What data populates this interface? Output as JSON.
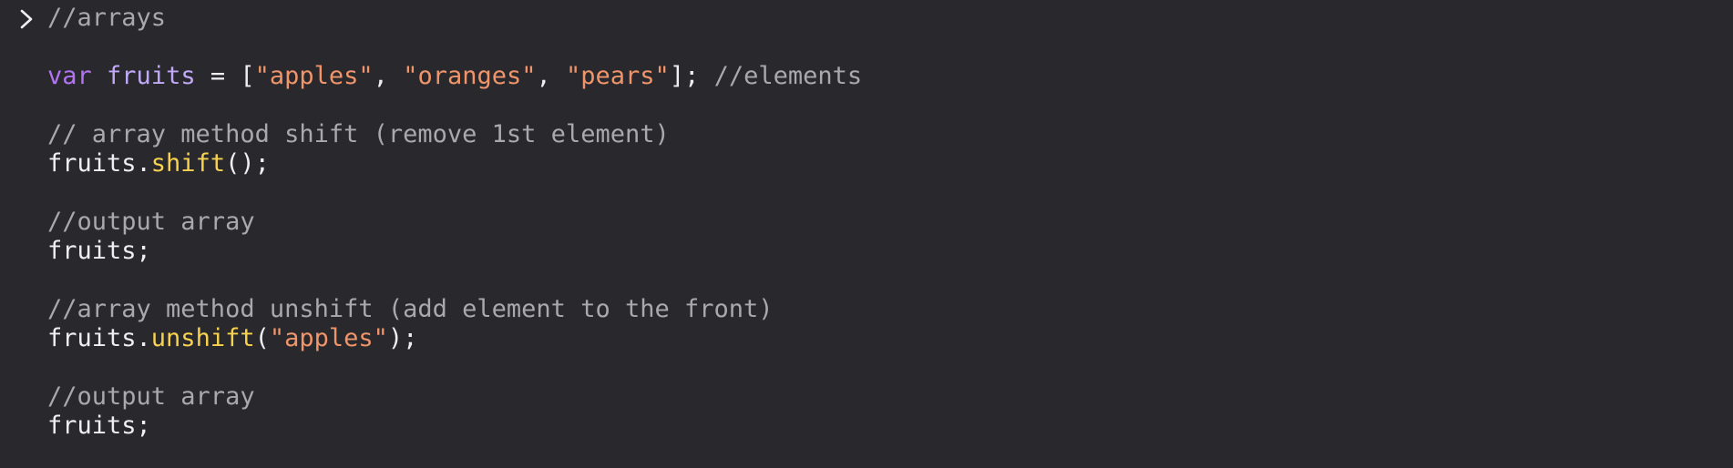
{
  "console": {
    "prompt_icon": "chevron-right-icon",
    "lines": [
      [
        {
          "t": "//arrays",
          "k": "cm"
        }
      ],
      [],
      [
        {
          "t": "var",
          "k": "kw"
        },
        {
          "t": " ",
          "k": "pl"
        },
        {
          "t": "fruits",
          "k": "var"
        },
        {
          "t": " = [",
          "k": "pl"
        },
        {
          "t": "\"apples\"",
          "k": "str"
        },
        {
          "t": ", ",
          "k": "pl"
        },
        {
          "t": "\"oranges\"",
          "k": "str"
        },
        {
          "t": ", ",
          "k": "pl"
        },
        {
          "t": "\"pears\"",
          "k": "str"
        },
        {
          "t": "]; ",
          "k": "pl"
        },
        {
          "t": "//elements",
          "k": "cm"
        }
      ],
      [],
      [
        {
          "t": "// array method shift (remove 1st element)",
          "k": "cm"
        }
      ],
      [
        {
          "t": "fruits.",
          "k": "pl"
        },
        {
          "t": "shift",
          "k": "fn"
        },
        {
          "t": "();",
          "k": "pl"
        }
      ],
      [],
      [
        {
          "t": "//output array",
          "k": "cm"
        }
      ],
      [
        {
          "t": "fruits;",
          "k": "pl"
        }
      ],
      [],
      [
        {
          "t": "//array method unshift (add element to the front)",
          "k": "cm"
        }
      ],
      [
        {
          "t": "fruits.",
          "k": "pl"
        },
        {
          "t": "unshift",
          "k": "fn"
        },
        {
          "t": "(",
          "k": "pl"
        },
        {
          "t": "\"apples\"",
          "k": "str"
        },
        {
          "t": ");",
          "k": "pl"
        }
      ],
      [],
      [
        {
          "t": "//output array",
          "k": "cm"
        }
      ],
      [
        {
          "t": "fruits;",
          "k": "pl"
        }
      ]
    ]
  }
}
